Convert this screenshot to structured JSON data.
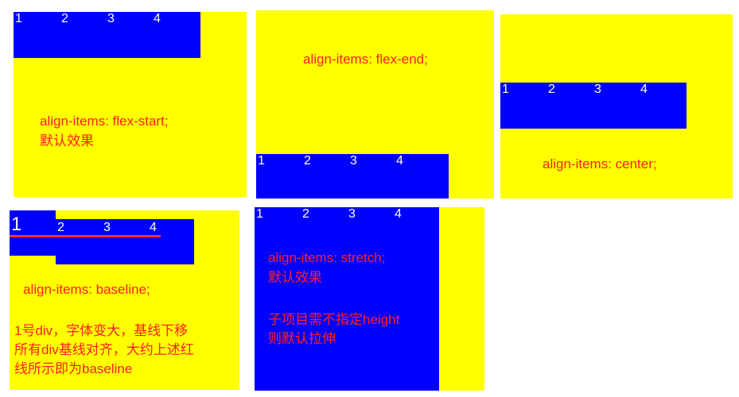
{
  "items": [
    "1",
    "2",
    "3",
    "4"
  ],
  "colors": {
    "container": "#ffff00",
    "item": "#0000ff",
    "item_text": "#ffffff",
    "caption": "#ff2020"
  },
  "panels": {
    "flex_start": {
      "line1": "align-items: flex-start;",
      "line2": "默认效果"
    },
    "flex_end": {
      "line1": "align-items: flex-end;"
    },
    "center": {
      "line1": "align-items: center;"
    },
    "baseline": {
      "line1": "align-items: baseline;",
      "note1": "1号div，字体变大，基线下移",
      "note2": "所有div基线对齐，大约上述红",
      "note3": "线所示即为baseline"
    },
    "stretch": {
      "line1": "align-items: stretch;",
      "line2": "默认效果",
      "note1": "子项目需不指定height",
      "note2": "则默认拉伸"
    }
  }
}
